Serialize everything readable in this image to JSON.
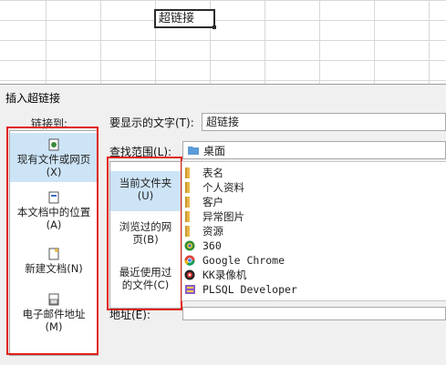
{
  "sheet": {
    "selected_cell_text": "超链接"
  },
  "dialog": {
    "title": "插入超链接",
    "link_to_label": "链接到:",
    "link_to_items": [
      {
        "label": "现有文件或网页",
        "accel": "(X)",
        "icon": "globe-document-icon",
        "selected": true
      },
      {
        "label": "本文档中的位置",
        "accel": "(A)",
        "icon": "document-place-icon",
        "selected": false
      },
      {
        "label": "新建文档",
        "accel": "(N)",
        "icon": "new-document-icon",
        "selected": false
      },
      {
        "label": "电子邮件地址",
        "accel": "(M)",
        "icon": "email-icon",
        "selected": false
      }
    ],
    "display_text_label": "要显示的文字(T):",
    "display_text_value": "超链接",
    "look_in_label": "查找范围(L):",
    "look_in_value": "桌面",
    "nav_items": [
      {
        "line1": "当前文件夹",
        "line2": "(U)",
        "selected": true
      },
      {
        "line1": "浏览过的网",
        "line2": "页(B)",
        "selected": false
      },
      {
        "line1": "最近使用过",
        "line2": "的文件(C)",
        "selected": false
      }
    ],
    "files": [
      {
        "name": "表名",
        "icon": "folder-icon"
      },
      {
        "name": "个人资料",
        "icon": "folder-icon"
      },
      {
        "name": "客户",
        "icon": "folder-icon"
      },
      {
        "name": "异常图片",
        "icon": "folder-icon"
      },
      {
        "name": "资源",
        "icon": "folder-icon"
      },
      {
        "name": "360",
        "icon": "360-browser-icon"
      },
      {
        "name": "Google Chrome",
        "icon": "chrome-icon"
      },
      {
        "name": "KK录像机",
        "icon": "kk-recorder-icon"
      },
      {
        "name": "PLSQL Developer",
        "icon": "plsql-icon"
      }
    ],
    "address_label": "地址(E):"
  },
  "colors": {
    "highlight_red": "#e2231a",
    "selection_blue": "#cde4f7",
    "folder_yellow": "#e8b84a"
  }
}
